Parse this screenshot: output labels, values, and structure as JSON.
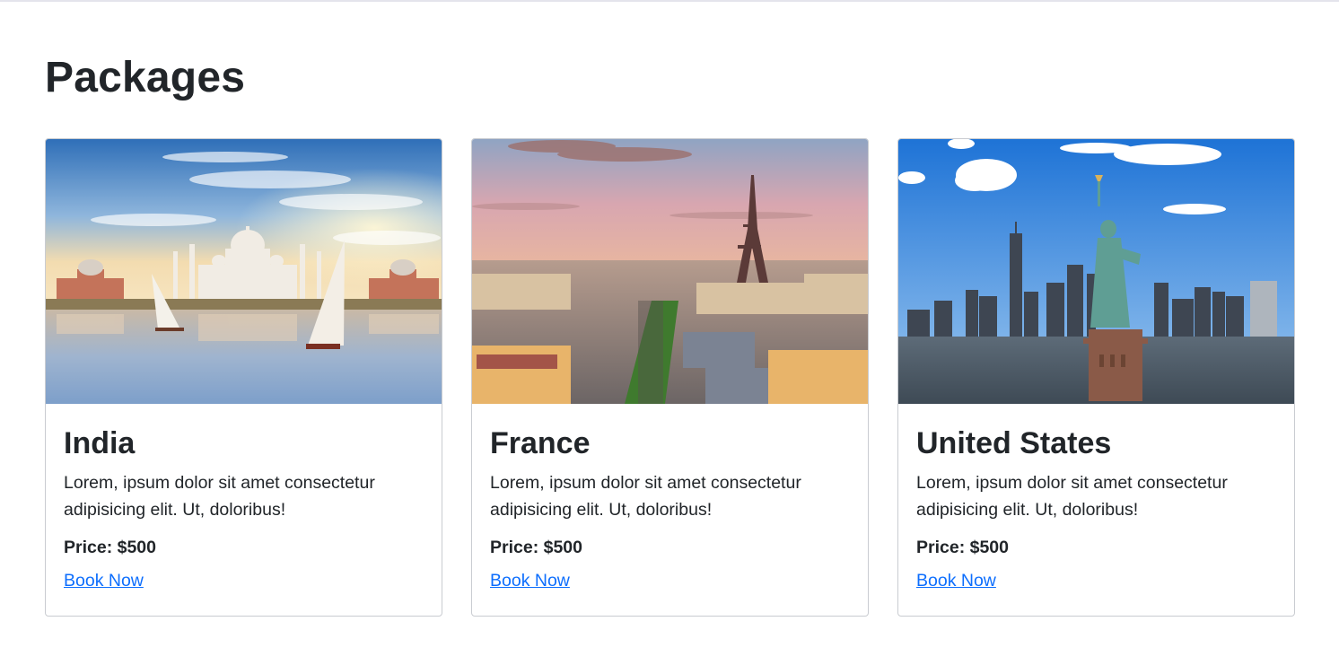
{
  "page": {
    "title": "Packages"
  },
  "packages": [
    {
      "name": "India",
      "description": "Lorem, ipsum dolor sit amet consectetur adipisicing elit. Ut, doloribus!",
      "price": "Price: $500",
      "cta": "Book Now",
      "image": "taj-mahal-scene"
    },
    {
      "name": "France",
      "description": "Lorem, ipsum dolor sit amet consectetur adipisicing elit. Ut, doloribus!",
      "price": "Price: $500",
      "cta": "Book Now",
      "image": "eiffel-tower-scene"
    },
    {
      "name": "United States",
      "description": "Lorem, ipsum dolor sit amet consectetur adipisicing elit. Ut, doloribus!",
      "price": "Price: $500",
      "cta": "Book Now",
      "image": "statue-of-liberty-scene"
    }
  ],
  "colors": {
    "link": "#0d6efd",
    "text": "#212529",
    "border": "#c9ccd1"
  }
}
